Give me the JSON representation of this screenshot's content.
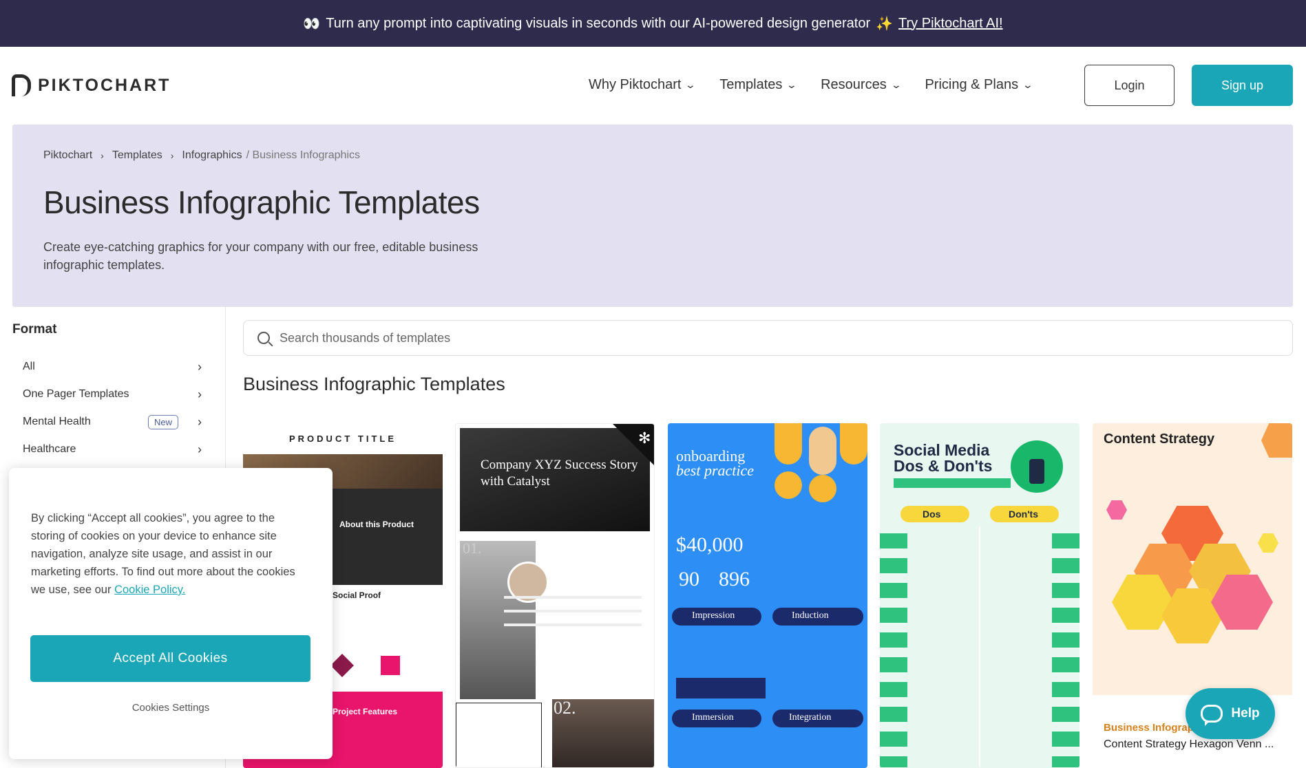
{
  "topbar": {
    "emoji": "👀",
    "message": "Turn any prompt into captivating visuals in seconds with our AI-powered design generator",
    "sparkle": "✨",
    "link": "Try Piktochart AI!"
  },
  "header": {
    "logo": "PIKTOCHART",
    "nav": [
      {
        "label": "Why Piktochart"
      },
      {
        "label": "Templates"
      },
      {
        "label": "Resources"
      },
      {
        "label": "Pricing & Plans"
      }
    ],
    "login": "Login",
    "signup": "Sign up"
  },
  "breadcrumb": {
    "items": [
      "Piktochart",
      "Templates",
      "Infographics"
    ],
    "current": "/ Business Infographics"
  },
  "hero": {
    "title": "Business Infographic Templates",
    "description": "Create eye-catching graphics for your company with our free, editable business infographic templates."
  },
  "sidebar": {
    "heading": "Format",
    "items": [
      {
        "label": "All"
      },
      {
        "label": "One Pager Templates"
      },
      {
        "label": "Mental Health",
        "badge": "New"
      },
      {
        "label": "Healthcare"
      }
    ]
  },
  "search": {
    "placeholder": "Search thousands of templates"
  },
  "section_title": "Business Infographic Templates",
  "cards": [
    {
      "heading": "PRODUCT TITLE",
      "sub1": "About this Product",
      "sub2": "Social Proof",
      "sub3": "Project Features"
    },
    {
      "heading": "Company XYZ Success Story with Catalyst",
      "num1": "01.",
      "num2": "02."
    },
    {
      "heading": "onboarding",
      "heading2": "best practice",
      "stat1": "$40,000",
      "stat2": "90",
      "stat3": "896",
      "pill1": "Impression",
      "pill2": "Induction",
      "pill3": "Immersion",
      "pill4": "Integration"
    },
    {
      "heading": "Social Media Dos & Don'ts",
      "col1": "Dos",
      "col2": "Don'ts"
    },
    {
      "heading": "Content Strategy",
      "label": "Business Infographics",
      "name": "Content Strategy Hexagon Venn ..."
    }
  ],
  "cookie": {
    "text": "By clicking “Accept all cookies”, you agree to the storing of cookies on your device to enhance site navigation, analyze site usage, and assist in our marketing efforts. To find out more about the cookies we use, see our",
    "link": "Cookie Policy.",
    "accept": "Accept All Cookies",
    "settings": "Cookies Settings"
  },
  "help": {
    "label": "Help"
  },
  "colors": {
    "brand": "#1aa6b7",
    "topbar": "#2e2b4d",
    "hero": "#e2e0f1"
  }
}
